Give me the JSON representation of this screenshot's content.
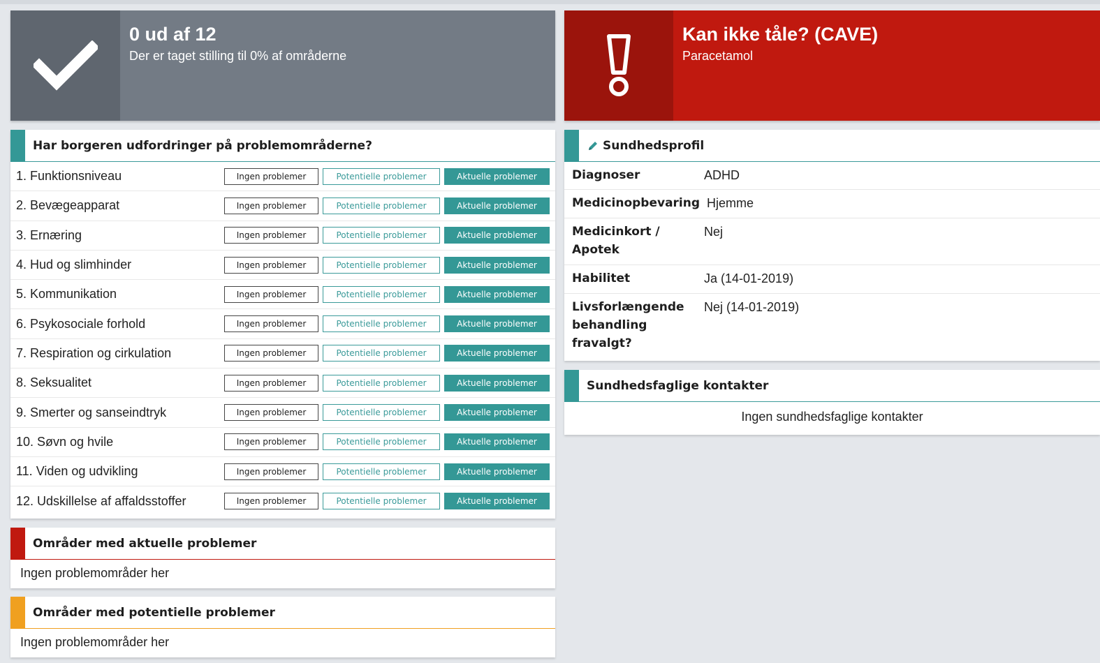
{
  "progress": {
    "title": "0 ud af 12",
    "subtitle": "Der er taget stilling til 0% af områderne",
    "percent": 0
  },
  "cave": {
    "title": "Kan ikke tåle? (CAVE)",
    "subtitle": "Paracetamol"
  },
  "problems": {
    "heading": "Har borgeren udfordringer på problemområderne?",
    "buttons": {
      "none": "Ingen problemer",
      "potential": "Potentielle problemer",
      "actual": "Aktuelle problemer"
    },
    "items": [
      {
        "label": "1. Funktionsniveau"
      },
      {
        "label": "2. Bevægeapparat"
      },
      {
        "label": "3. Ernæring"
      },
      {
        "label": "4. Hud og slimhinder"
      },
      {
        "label": "5. Kommunikation"
      },
      {
        "label": "6. Psykosociale forhold"
      },
      {
        "label": "7. Respiration og cirkulation"
      },
      {
        "label": "8. Seksualitet"
      },
      {
        "label": "9. Smerter og sanseindtryk"
      },
      {
        "label": "10. Søvn og hvile"
      },
      {
        "label": "11. Viden og udvikling"
      },
      {
        "label": "12. Udskillelse af affaldsstoffer"
      }
    ]
  },
  "actual_areas": {
    "heading": "Områder med aktuelle problemer",
    "empty": "Ingen problemområder her"
  },
  "potential_areas": {
    "heading": "Områder med potentielle problemer",
    "empty": "Ingen problemområder her"
  },
  "health_profile": {
    "heading": "Sundhedsprofil",
    "rows": [
      {
        "key": "Diagnoser",
        "value": "ADHD"
      },
      {
        "key": "Medicinopbevaring",
        "value": "Hjemme"
      },
      {
        "key": "Medicinkort / Apotek",
        "value": "Nej"
      },
      {
        "key": "Habilitet",
        "value": "Ja (14-01-2019)"
      },
      {
        "key": "Livsforlængende behandling fravalgt?",
        "value": "Nej (14-01-2019)"
      }
    ]
  },
  "contacts": {
    "heading": "Sundhedsfaglige kontakter",
    "empty": "Ingen sundhedsfaglige kontakter"
  },
  "colors": {
    "teal": "#349896",
    "red": "#c0190f",
    "orange": "#f0a020",
    "gray_tile": "#737b85"
  }
}
